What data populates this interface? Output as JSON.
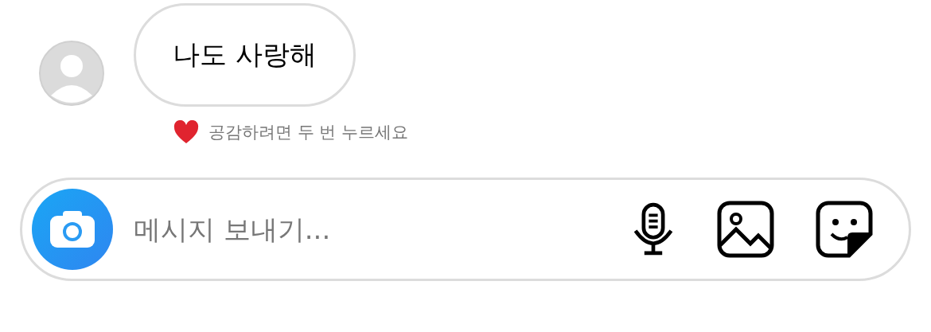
{
  "messages": [
    {
      "text": "나도 사랑해",
      "hint": "공감하려면 두 번 누르세요"
    }
  ],
  "composer": {
    "placeholder": "메시지 보내기..."
  }
}
